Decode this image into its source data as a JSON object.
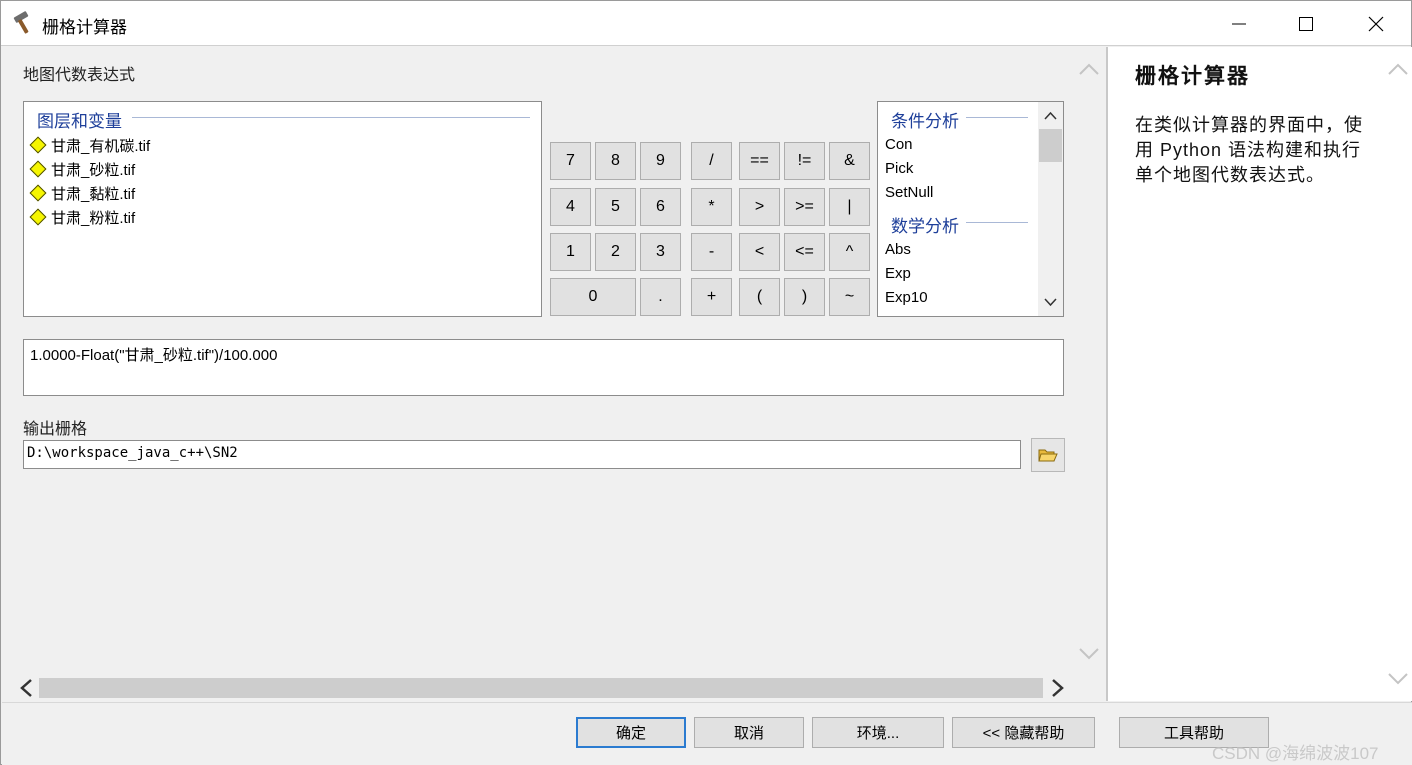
{
  "window": {
    "title": "栅格计算器",
    "icon": "hammer-icon"
  },
  "main": {
    "expression_label": "地图代数表达式",
    "layers_group_title": "图层和变量",
    "layers": [
      "甘肃_有机碳.tif",
      "甘肃_砂粒.tif",
      "甘肃_黏粒.tif",
      "甘肃_粉粒.tif"
    ],
    "keypad": {
      "rows": [
        [
          "7",
          "8",
          "9",
          "/",
          "==",
          "!=",
          "&"
        ],
        [
          "4",
          "5",
          "6",
          "*",
          ">",
          ">=",
          "|"
        ],
        [
          "1",
          "2",
          "3",
          "-",
          "<",
          "<=",
          "^"
        ],
        [
          "0",
          ".",
          "+",
          "(",
          ")",
          "~"
        ]
      ]
    },
    "functions": {
      "conditional_title": "条件分析",
      "conditional": [
        "Con",
        "Pick",
        "SetNull"
      ],
      "math_title": "数学分析",
      "math": [
        "Abs",
        "Exp",
        "Exp10"
      ]
    },
    "expression_value": "1.0000-Float(\"甘肃_砂粒.tif\")/100.000",
    "output_label": "输出栅格",
    "output_value": "D:\\workspace_java_c++\\SN2"
  },
  "help": {
    "title": "栅格计算器",
    "text": "在类似计算器的界面中，使用 Python 语法构建和执行单个地图代数表达式。"
  },
  "buttons": {
    "ok": "确定",
    "cancel": "取消",
    "environments": "环境...",
    "hide_help": "<< 隐藏帮助",
    "tool_help": "工具帮助"
  },
  "watermark": "CSDN @海绵波波107"
}
